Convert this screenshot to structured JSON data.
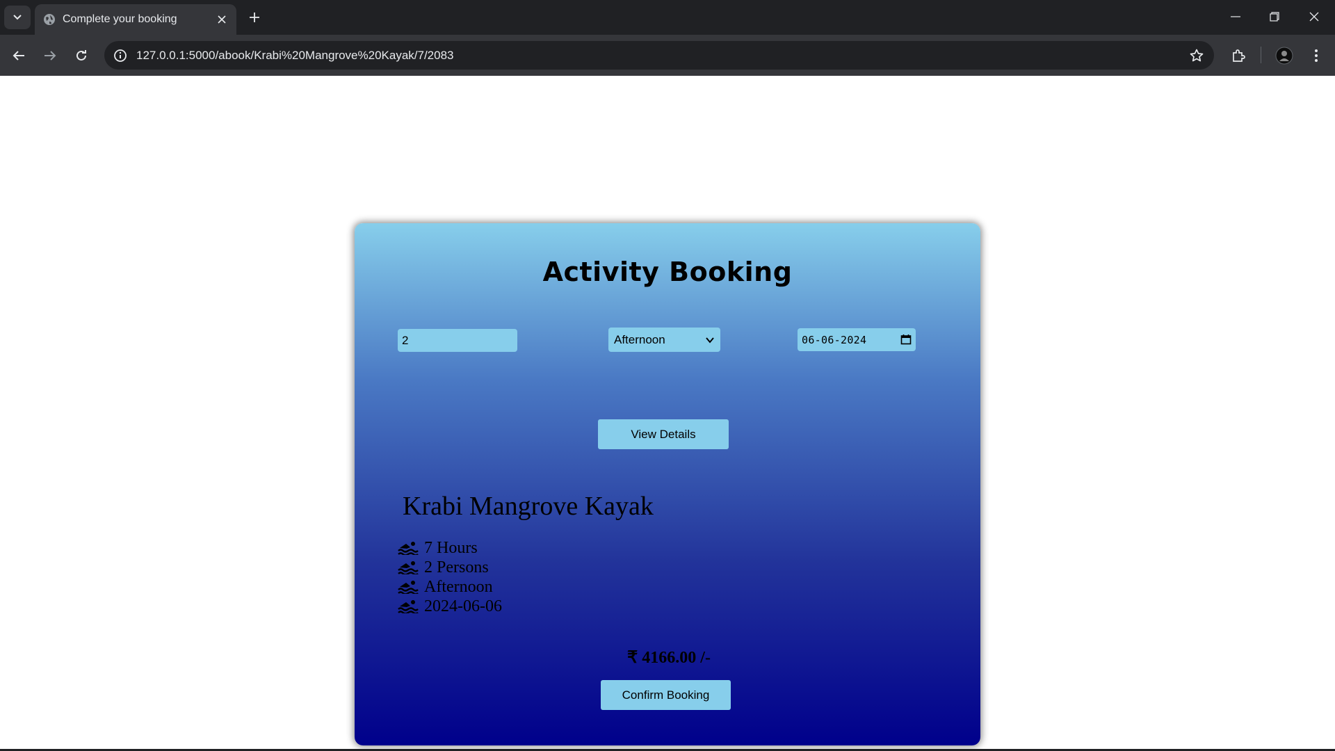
{
  "browser": {
    "tab_title": "Complete your booking",
    "url": "127.0.0.1:5000/abook/Krabi%20Mangrove%20Kayak/7/2083",
    "icons": [
      "tab-list-icon",
      "globe-icon",
      "close-icon",
      "plus-icon",
      "minimize-icon",
      "restore-icon",
      "close-window-icon",
      "back-arrow-icon",
      "forward-arrow-icon",
      "reload-icon",
      "info-icon",
      "star-icon",
      "extensions-icon",
      "profile-avatar-icon",
      "kebab-menu-icon"
    ]
  },
  "booking": {
    "title": "Activity Booking",
    "persons_value": "2",
    "time_selected": "Afternoon",
    "date_value": "06-06-2024",
    "view_details_label": "View Details",
    "activity_name": "Krabi Mangrove Kayak",
    "details": [
      {
        "icon": "swimmer-icon",
        "text": "7 Hours"
      },
      {
        "icon": "swimmer-icon",
        "text": "2 Persons"
      },
      {
        "icon": "swimmer-icon",
        "text": "Afternoon"
      },
      {
        "icon": "swimmer-icon",
        "text": "2024-06-06"
      }
    ],
    "price": "₹ 4166.00 /-",
    "confirm_label": "Confirm Booking"
  },
  "colors": {
    "card_gradient_top": "#87ceeb",
    "card_gradient_bottom": "#00008b",
    "control_background": "#87ceeb",
    "chrome_dark": "#202124",
    "chrome_toolbar": "#35363a"
  }
}
